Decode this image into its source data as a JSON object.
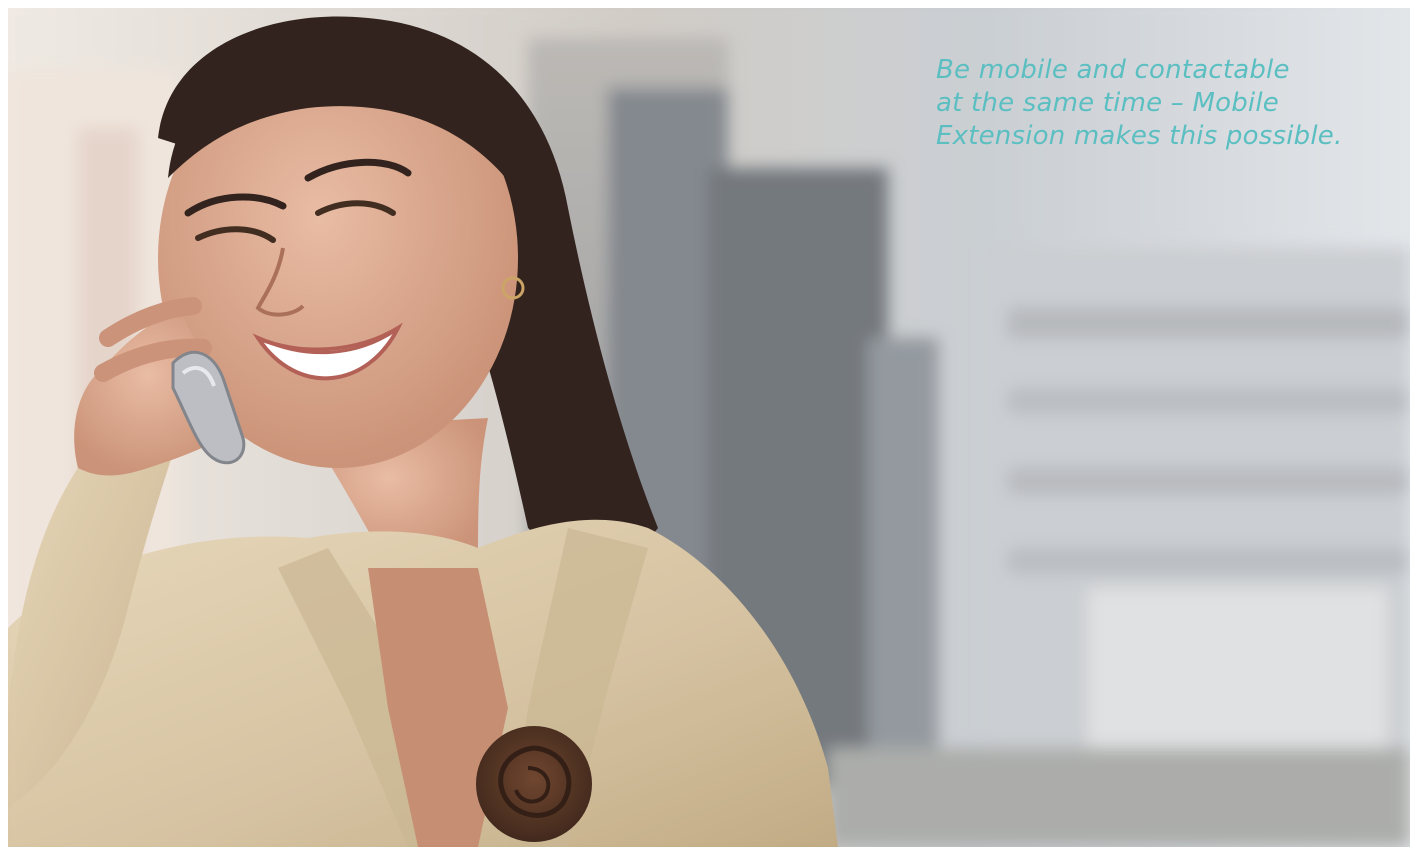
{
  "caption": {
    "lines": [
      "Be mobile and contactable",
      "at the same time – Mobile",
      "Extension makes this possible."
    ]
  },
  "photo": {
    "subject": "smiling woman talking on a mobile phone",
    "setting": "blurred city buildings background",
    "colors": {
      "jacket": "#d8c6a4",
      "hair": "#2a1a14",
      "skin": "#d9a48a",
      "brooch": "#4a2a1a",
      "caption_text": "#5bbfc2"
    }
  }
}
